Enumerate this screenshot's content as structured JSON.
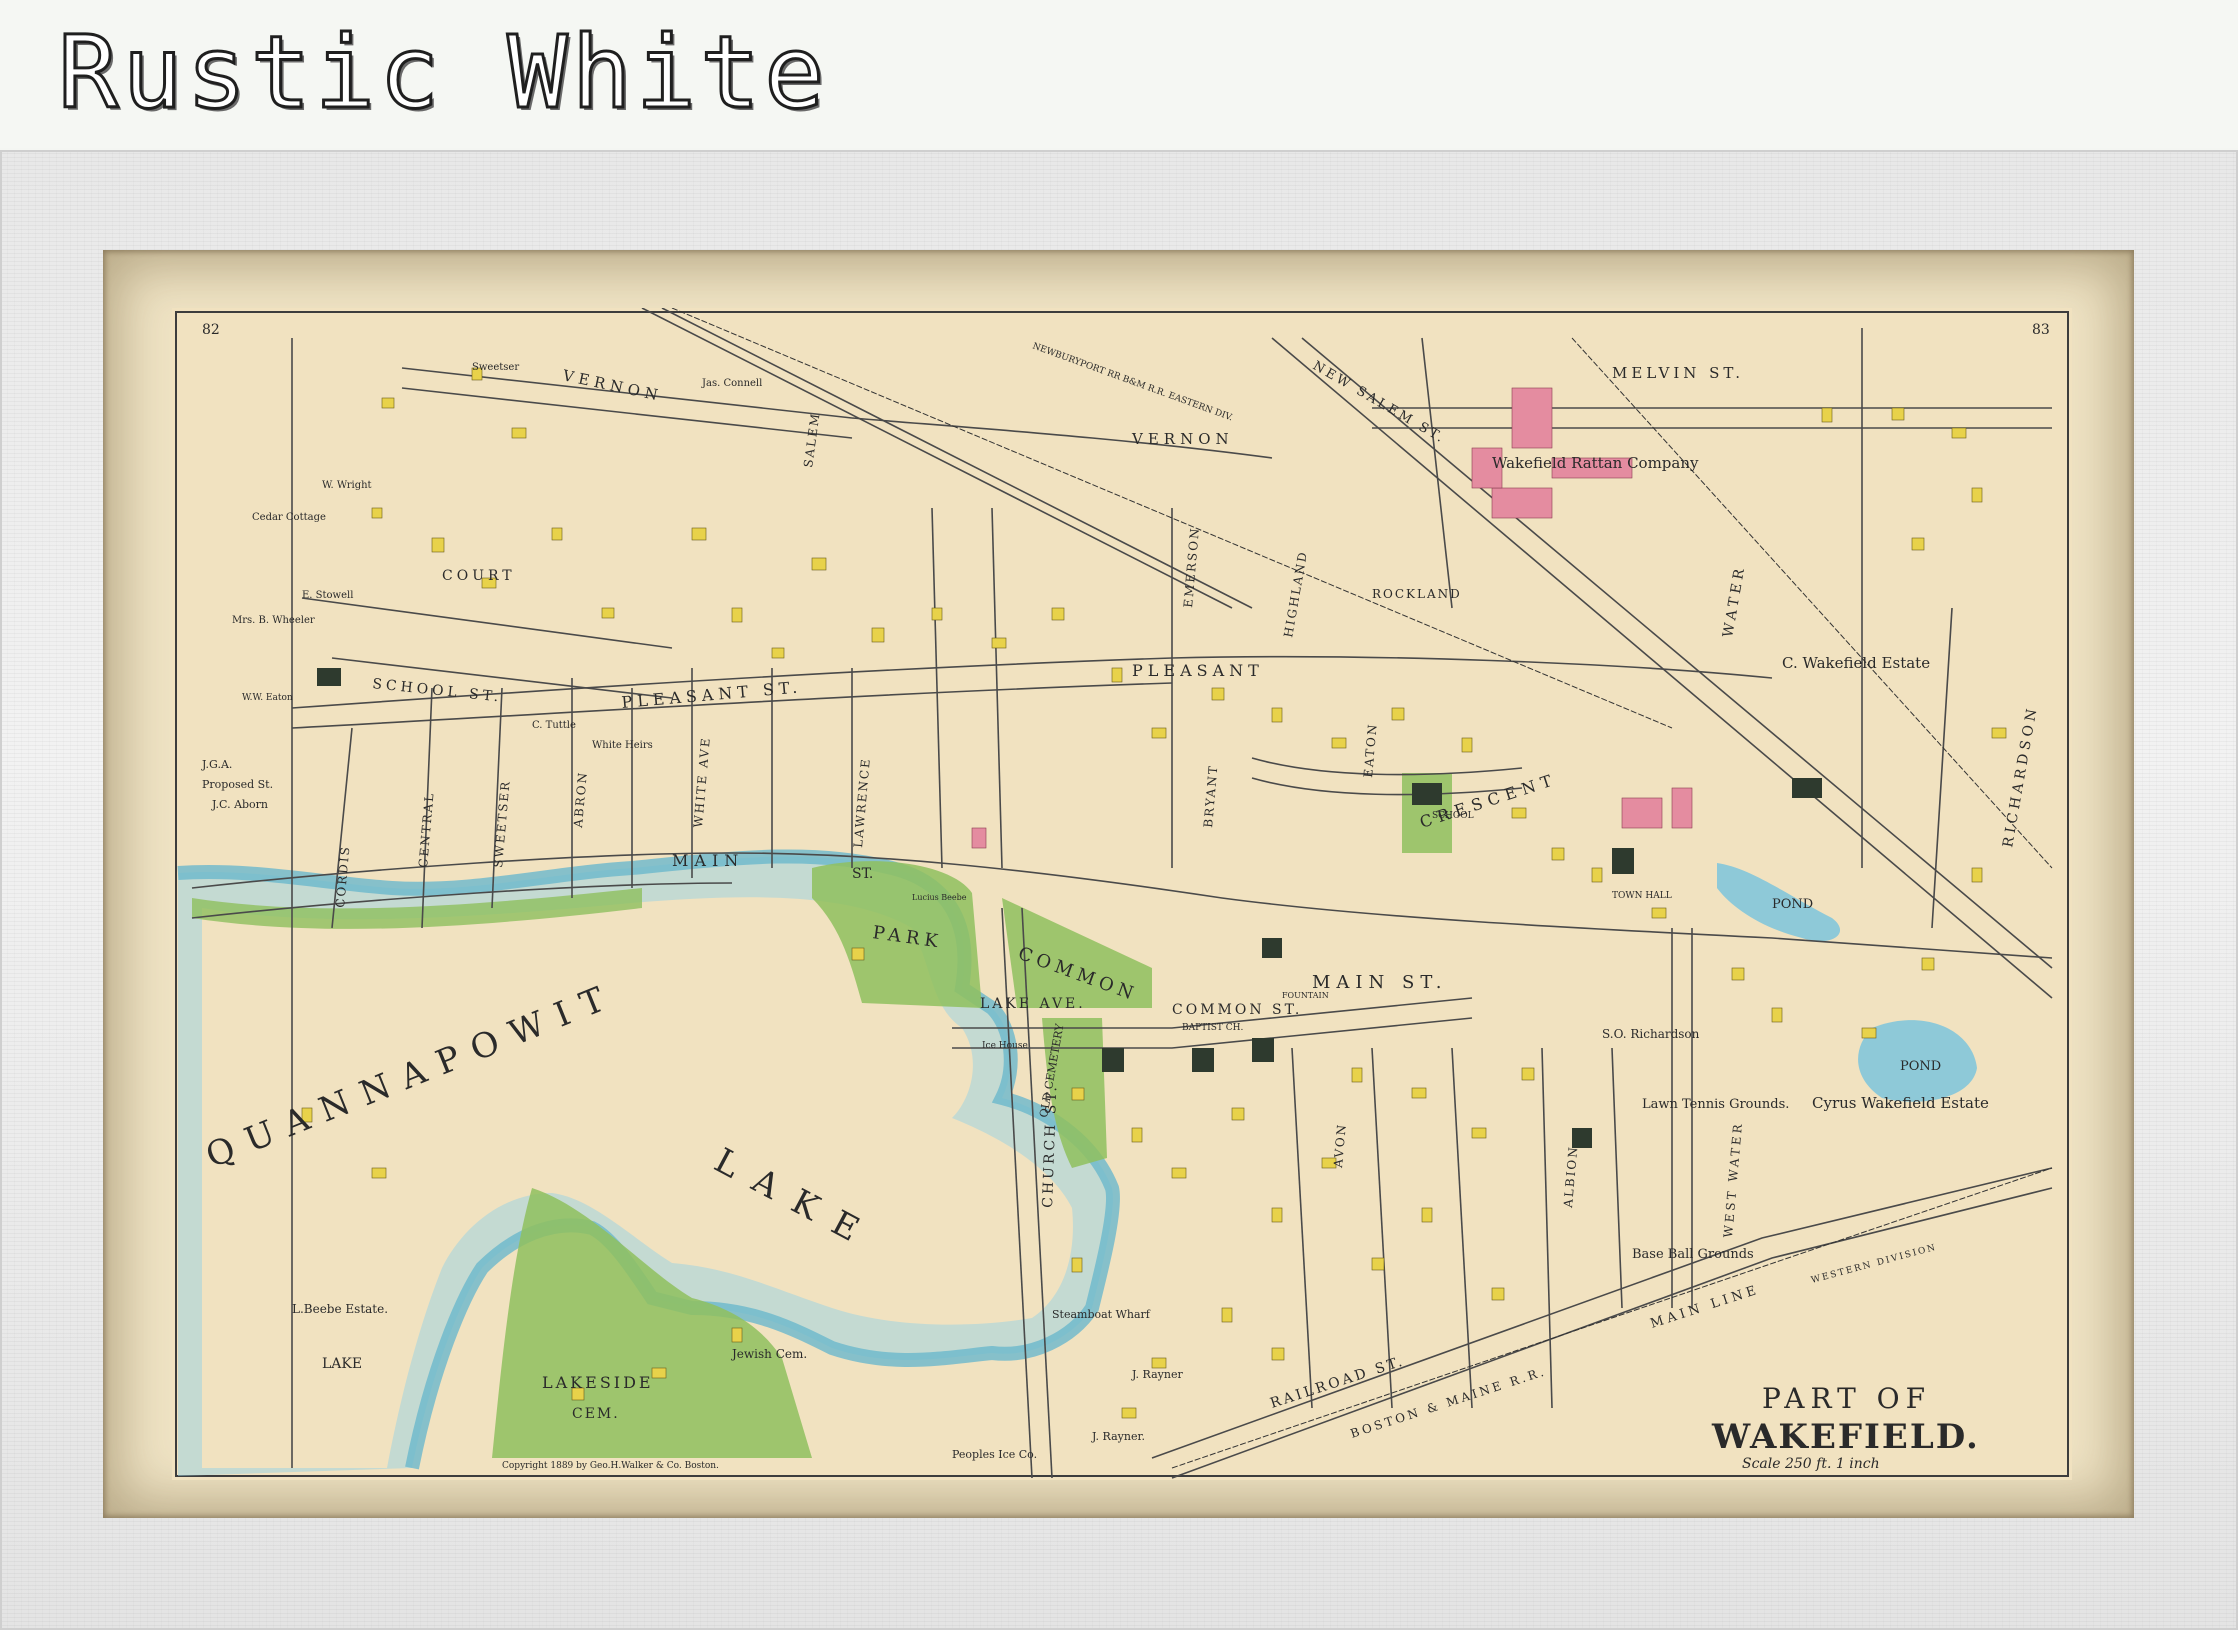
{
  "banner": {
    "title": "Rustic White"
  },
  "frame": {
    "style": "Rustic White"
  },
  "map": {
    "page_numbers": {
      "left": "82",
      "right": "83"
    },
    "title_line1": "PART OF",
    "title_line2": "WAKEFIELD.",
    "scale": "Scale 250 ft. 1 inch",
    "copyright": "Copyright 1889 by Geo.H.Walker & Co. Boston.",
    "water_labels": {
      "lake_main": "QUANNAPOWIT",
      "lake_word": "LAKE",
      "pond_upper": "POND",
      "pond_lower": "POND",
      "lake_small": "LAKE"
    },
    "streets": {
      "main_west": "MAIN",
      "main_st": "ST.",
      "main_east": "MAIN ST.",
      "pleasant": "PLEASANT ST.",
      "pleasant_east": "PLEASANT",
      "vernon_west": "VERNON",
      "vernon_east": "VERNON",
      "court": "COURT",
      "school": "SCHOOL ST.",
      "common": "COMMON ST.",
      "lake_ave": "LAKE AVE.",
      "crescent": "CRESCENT",
      "melvin": "MELVIN ST.",
      "new_salem": "NEW SALEM ST.",
      "water": "WATER",
      "west_water": "WEST WATER",
      "richardson": "RICHARDSON",
      "church": "CHURCH ST.",
      "railroad": "RAILROAD ST.",
      "boston_maine": "BOSTON & MAINE R.R.",
      "main_line": "MAIN LINE",
      "western_division": "WESTERN DIVISION",
      "salem": "SALEM",
      "rockland": "ROCKLAND",
      "highland": "HIGHLAND",
      "cordis": "CORDIS",
      "central": "CENTRAL",
      "sweetser": "SWEETSER",
      "abron": "ABRON",
      "white_ave": "WHITE AVE",
      "lawrence": "LAWRENCE",
      "eaton": "EATON",
      "albion": "ALBION",
      "avon": "AVON",
      "bryant": "BRYANT",
      "emerson": "EMERSON",
      "newbury_rr": "NEWBURYPORT RR B&M R.R. EASTERN DIV."
    },
    "places": {
      "park": "PARK",
      "common": "COMMON",
      "lakeside_cem": "LAKESIDE",
      "lakeside_cem2": "CEM.",
      "jewish_cem": "Jewish Cem.",
      "old_cemetery": "OLD CEMETERY",
      "rattan": "Wakefield Rattan Company",
      "c_wakefield": "C. Wakefield Estate",
      "cyrus_wakefield": "Cyrus Wakefield Estate",
      "lawn_tennis": "Lawn Tennis Grounds.",
      "base_ball": "Base Ball Grounds",
      "beebe_estate": "L.Beebe Estate.",
      "steamboat": "Steamboat Wharf",
      "peoples_ice": "Peoples Ice Co.",
      "rayner": "J. Rayner",
      "rayner2": "J. Rayner.",
      "so_richardson": "S.O. Richardson",
      "town_hall": "TOWN HALL",
      "school_a": "SCHOOL",
      "baptist": "BAPTIST CH.",
      "proposed_st": "Proposed St.",
      "jga": "J.G.A.",
      "jc_aborn": "J.C. Aborn",
      "sweetser_name": "Sweetser",
      "conwell": "Jas. Connell",
      "w_wright": "W. Wright",
      "cedar_cottage": "Cedar Cottage",
      "e_stowell": "E. Stowell",
      "mrs_wheeler": "Mrs. B. Wheeler",
      "ww_eaton": "W.W. Eaton",
      "white_heirs": "White Heirs",
      "tuttle": "C. Tuttle",
      "lucius_beebe": "Lucius Beebe",
      "ice_house": "Ice House",
      "fountain": "FOUNTAIN"
    }
  }
}
